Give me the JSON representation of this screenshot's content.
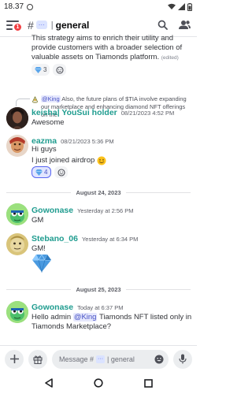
{
  "status_bar": {
    "time": "18.37"
  },
  "header": {
    "channel_tag": "···",
    "channel_name": "general",
    "notification_count": "1"
  },
  "messages": {
    "partial_text": "This strategy aims to enrich their utility and provide customers with a broader selection of valuable assets on Tiamonds platform.",
    "partial_edited": "(edited)",
    "partial_reactions": [
      {
        "emoji": "diamond",
        "count": "3"
      }
    ],
    "reply_author": "@King",
    "reply_text": "Also, the future plans of $TIA involve expanding our marketplace and enhancing diamond NFT offerings on the",
    "m1_author": "keisha| YouSui holder",
    "m1_time": "08/21/2023 4:52 PM",
    "m1_text": "Awesome",
    "m2_author": "eazma",
    "m2_time": "08/21/2023 5:36 PM",
    "m2_text1": "Hi guys",
    "m2_text2": "I just joined airdrop",
    "m2_reaction_count": "4",
    "divider1": "August 24, 2023",
    "m3_author": "Gowonase",
    "m3_time": "Yesterday at 2:56 PM",
    "m3_text": "GM",
    "m4_author": "Stebano_06",
    "m4_time": "Yesterday at 6:34 PM",
    "m4_text": "GM!",
    "divider2": "August 25, 2023",
    "m5_author": "Gowonase",
    "m5_time": "Today at 6:37 PM",
    "m5_text_pre": "Hello admin",
    "m5_mention": "@King",
    "m5_text_post": "Tiamonds NFT listed only in Tiamonds Marketplace?"
  },
  "composer": {
    "placeholder_prefix": "Message #",
    "placeholder_tag": "···",
    "placeholder_suffix": "| general"
  },
  "colors": {
    "accent": "#5865f2",
    "keisha_name": "#1f9c8f",
    "eazma_name": "#1f9c8f",
    "gowonase_name": "#1f9c8f",
    "stebano_name": "#1f9c8f",
    "mention_bg": "#e6e8fd"
  }
}
